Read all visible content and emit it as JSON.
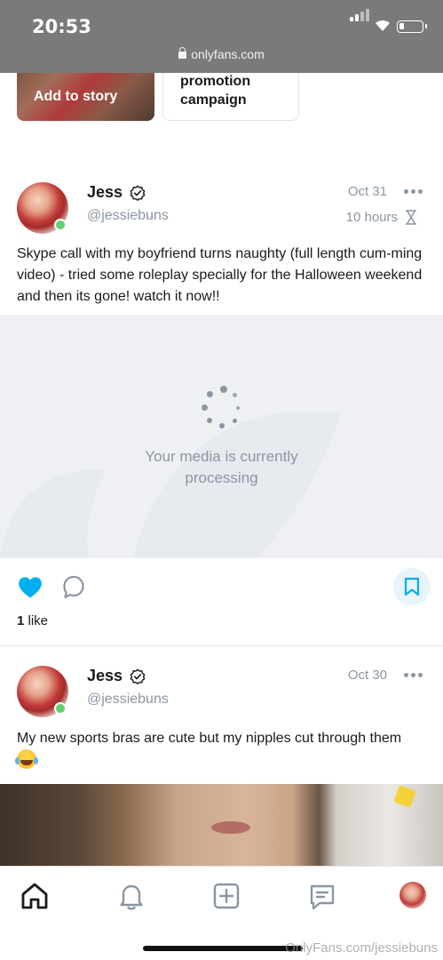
{
  "status_bar": {
    "time": "20:53",
    "url": "onlyfans.com",
    "battery_level": 0.15
  },
  "top_cards": {
    "story_label": "Add to story",
    "promo_label_line1": "promotion",
    "promo_label_line2": "campaign"
  },
  "posts": [
    {
      "author": "Jess",
      "handle": "@jessiebuns",
      "verified": true,
      "online": true,
      "date": "Oct 31",
      "expires_in": "10 hours",
      "text": "Skype call with my boyfriend turns naughty (full length cum-ming video) - tried some roleplay specially for the Halloween weekend and then its gone! watch it now!!",
      "media_status_line1": "Your media is currently",
      "media_status_line2": "processing",
      "liked": true,
      "likes_count": "1",
      "likes_label": "like"
    },
    {
      "author": "Jess",
      "handle": "@jessiebuns",
      "verified": true,
      "online": true,
      "date": "Oct 30",
      "text": "My new sports bras are cute but my nipples cut through them"
    }
  ],
  "tabbar": {
    "items": [
      "home-icon",
      "bell-icon",
      "add-post-icon",
      "messages-icon",
      "profile-avatar"
    ],
    "active": "home-icon"
  },
  "watermark": "OnlyFans.com/jessiebuns",
  "colors": {
    "accent": "#00aff0",
    "muted": "#8a96a3",
    "online": "#5fd16f"
  }
}
